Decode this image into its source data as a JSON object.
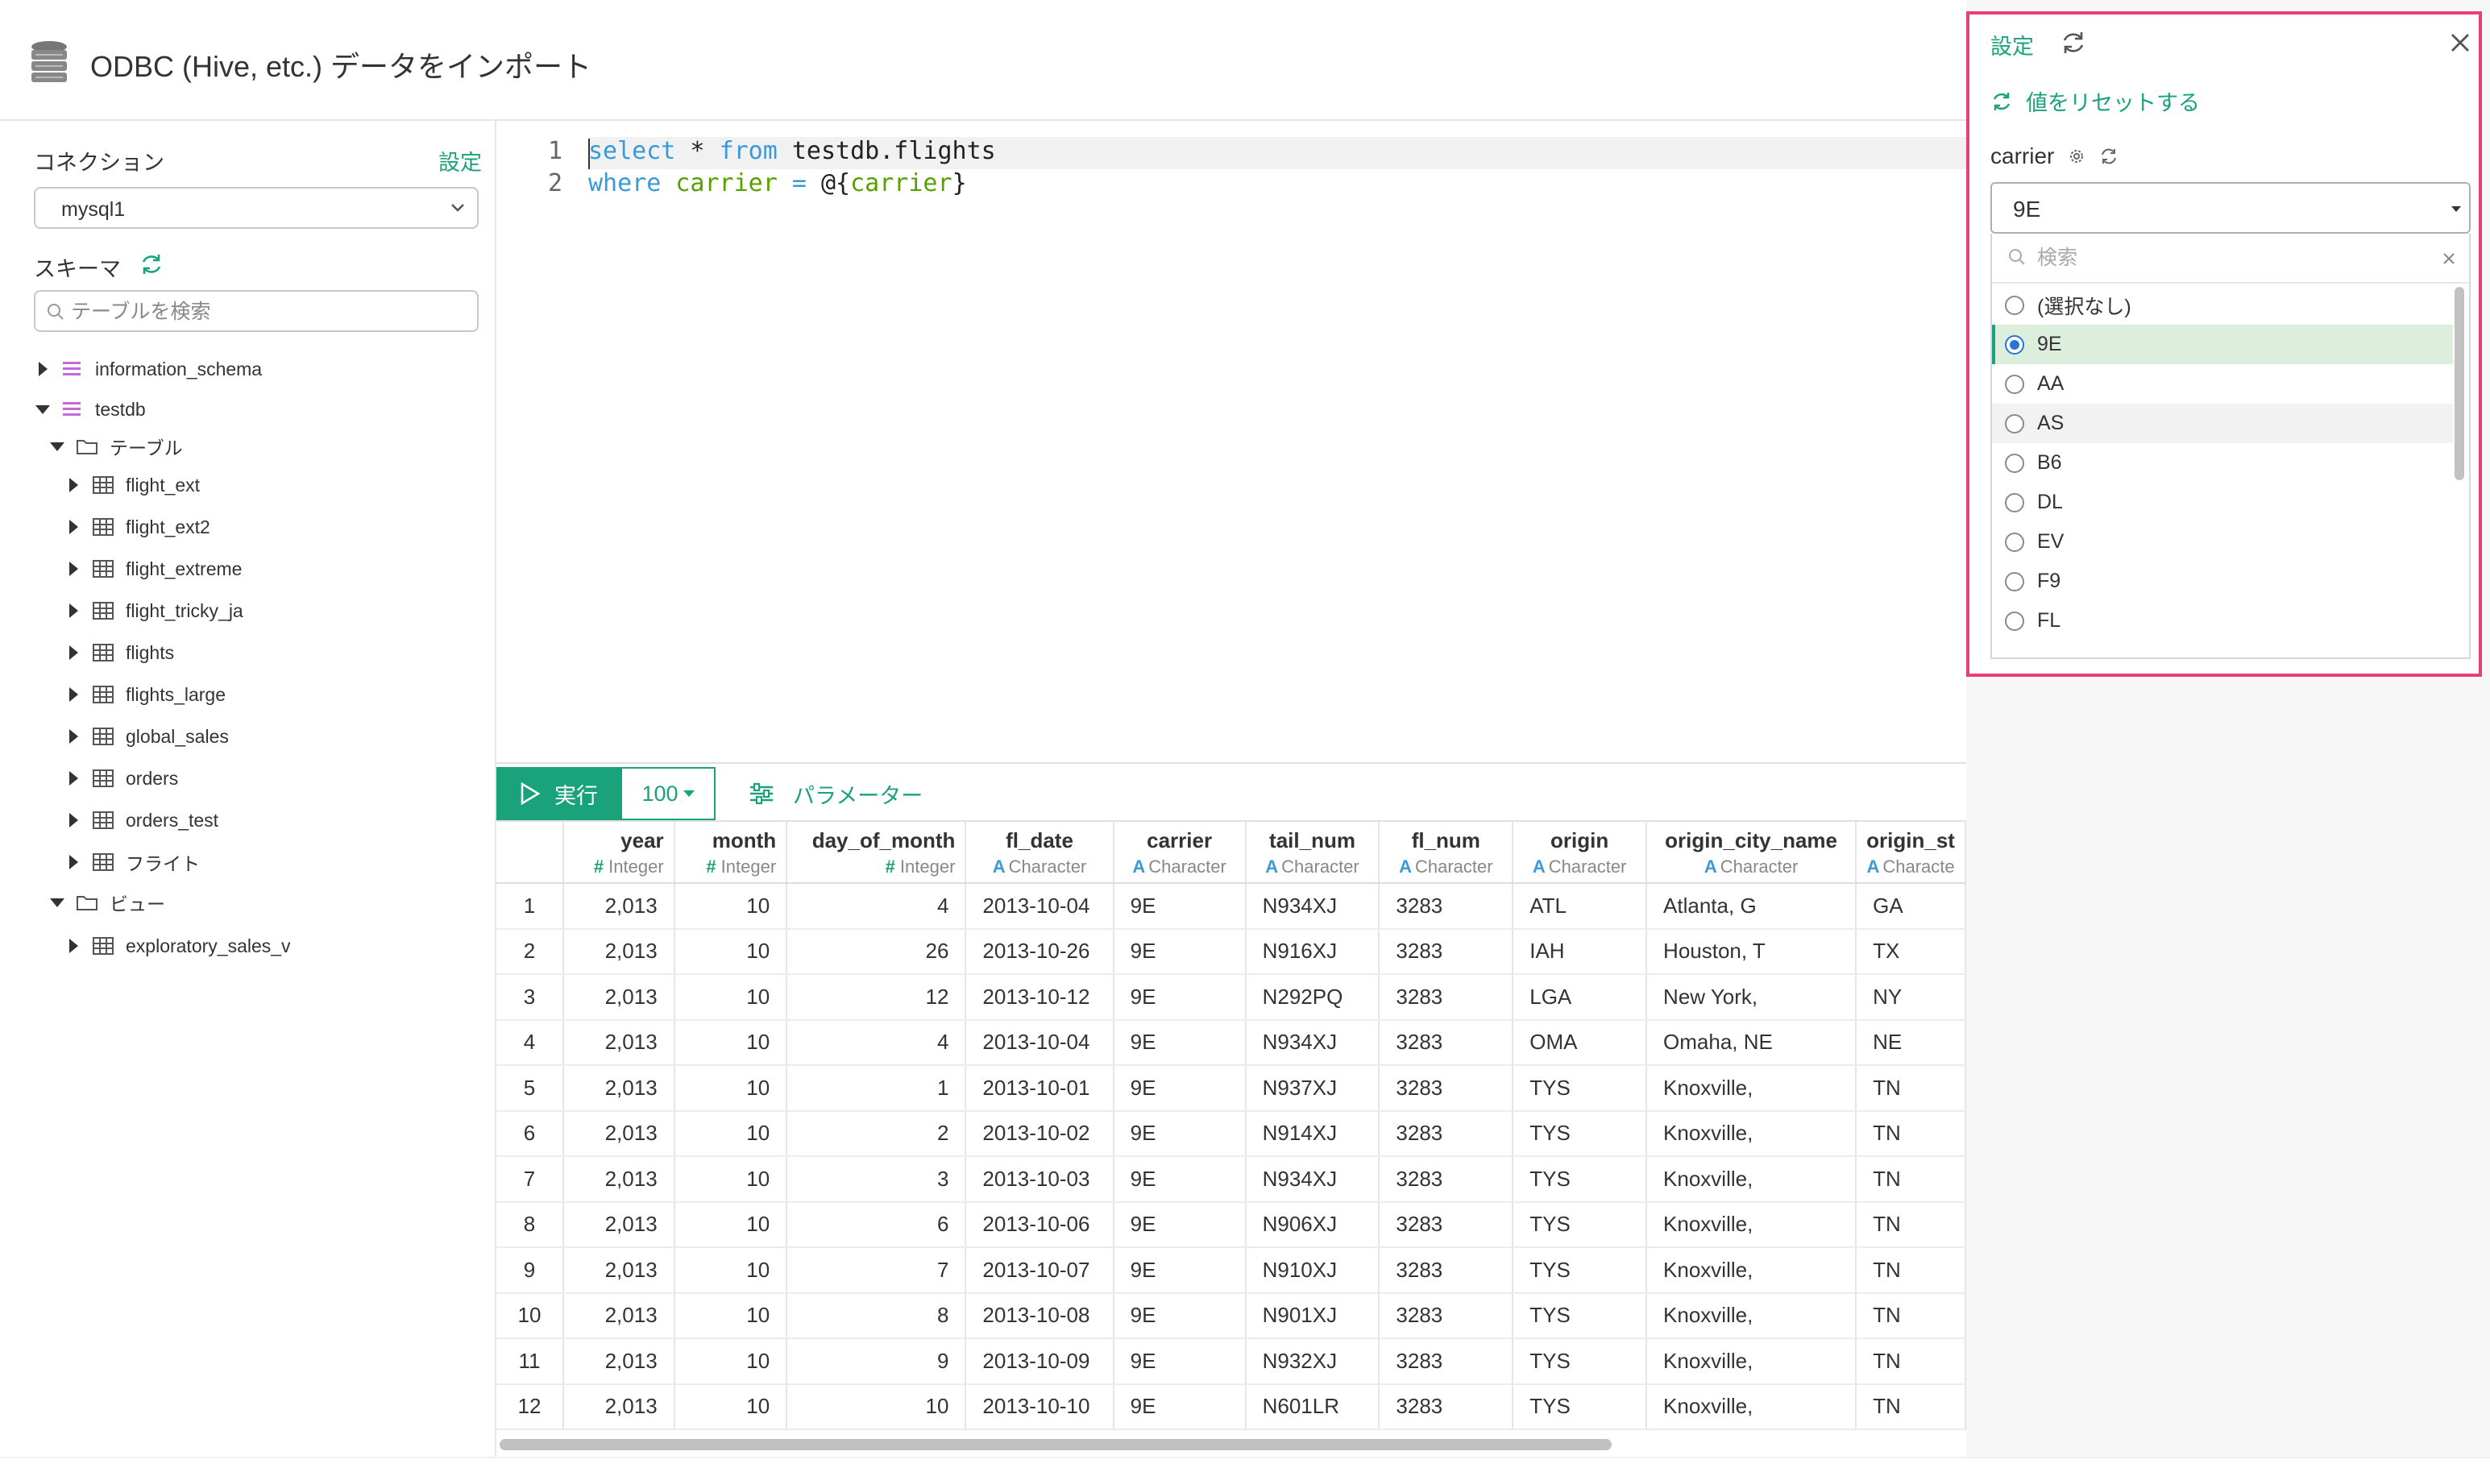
{
  "header": {
    "title": "ODBC (Hive, etc.) データをインポート"
  },
  "sidebar": {
    "connection_label": "コネクション",
    "settings_link": "設定",
    "connection_value": "mysql1",
    "schema_label": "スキーマ",
    "table_search_placeholder": "テーブルを検索",
    "tree": {
      "information_schema": "information_schema",
      "testdb": "testdb",
      "tables_folder": "テーブル",
      "tables": [
        "flight_ext",
        "flight_ext2",
        "flight_extreme",
        "flight_tricky_ja",
        "flights",
        "flights_large",
        "global_sales",
        "orders",
        "orders_test",
        "フライト"
      ],
      "views_folder": "ビュー",
      "views": [
        "exploratory_sales_v"
      ]
    }
  },
  "editor": {
    "line_numbers": [
      "1",
      "2"
    ],
    "line1": {
      "kw1": "select",
      "p1": " * ",
      "kw2": "from",
      "p2": " testdb.flights"
    },
    "line2": {
      "kw1": "where",
      "p1": " ",
      "param1": "carrier",
      "p2": " ",
      "kw2": "=",
      "p3": " @{",
      "param2": "carrier",
      "p4": "}"
    }
  },
  "toolbar": {
    "run_label": "実行",
    "limit_value": "100",
    "params_label": "パラメーター"
  },
  "grid": {
    "type_integer": "Integer",
    "type_character": "Character",
    "columns": [
      {
        "name": "year",
        "type": "Integer"
      },
      {
        "name": "month",
        "type": "Integer"
      },
      {
        "name": "day_of_month",
        "type": "Integer"
      },
      {
        "name": "fl_date",
        "type": "Character"
      },
      {
        "name": "carrier",
        "type": "Character"
      },
      {
        "name": "tail_num",
        "type": "Character"
      },
      {
        "name": "fl_num",
        "type": "Character"
      },
      {
        "name": "origin",
        "type": "Character"
      },
      {
        "name": "origin_city_name",
        "type": "Character"
      },
      {
        "name": "origin_st",
        "type": "Characte"
      }
    ],
    "rows": [
      [
        "1",
        "2,013",
        "10",
        "4",
        "2013-10-04",
        "9E",
        "N934XJ",
        "3283",
        "ATL",
        "Atlanta, G",
        "GA"
      ],
      [
        "2",
        "2,013",
        "10",
        "26",
        "2013-10-26",
        "9E",
        "N916XJ",
        "3283",
        "IAH",
        "Houston, T",
        "TX"
      ],
      [
        "3",
        "2,013",
        "10",
        "12",
        "2013-10-12",
        "9E",
        "N292PQ",
        "3283",
        "LGA",
        "New York,",
        "NY"
      ],
      [
        "4",
        "2,013",
        "10",
        "4",
        "2013-10-04",
        "9E",
        "N934XJ",
        "3283",
        "OMA",
        "Omaha, NE",
        "NE"
      ],
      [
        "5",
        "2,013",
        "10",
        "1",
        "2013-10-01",
        "9E",
        "N937XJ",
        "3283",
        "TYS",
        "Knoxville,",
        "TN"
      ],
      [
        "6",
        "2,013",
        "10",
        "2",
        "2013-10-02",
        "9E",
        "N914XJ",
        "3283",
        "TYS",
        "Knoxville,",
        "TN"
      ],
      [
        "7",
        "2,013",
        "10",
        "3",
        "2013-10-03",
        "9E",
        "N934XJ",
        "3283",
        "TYS",
        "Knoxville,",
        "TN"
      ],
      [
        "8",
        "2,013",
        "10",
        "6",
        "2013-10-06",
        "9E",
        "N906XJ",
        "3283",
        "TYS",
        "Knoxville,",
        "TN"
      ],
      [
        "9",
        "2,013",
        "10",
        "7",
        "2013-10-07",
        "9E",
        "N910XJ",
        "3283",
        "TYS",
        "Knoxville,",
        "TN"
      ],
      [
        "10",
        "2,013",
        "10",
        "8",
        "2013-10-08",
        "9E",
        "N901XJ",
        "3283",
        "TYS",
        "Knoxville,",
        "TN"
      ],
      [
        "11",
        "2,013",
        "10",
        "9",
        "2013-10-09",
        "9E",
        "N932XJ",
        "3283",
        "TYS",
        "Knoxville,",
        "TN"
      ],
      [
        "12",
        "2,013",
        "10",
        "10",
        "2013-10-10",
        "9E",
        "N601LR",
        "3283",
        "TYS",
        "Knoxville,",
        "TN"
      ]
    ]
  },
  "panel": {
    "settings_label": "設定",
    "reset_label": "値をリセットする",
    "param_name": "carrier",
    "selected_value": "9E",
    "search_placeholder": "検索",
    "options": [
      "(選択なし)",
      "9E",
      "AA",
      "AS",
      "B6",
      "DL",
      "EV",
      "F9",
      "FL"
    ]
  },
  "colors": {
    "accent": "#1aa37a",
    "keyword": "#3a9ad9",
    "highlight_border": "#e83e7c"
  }
}
